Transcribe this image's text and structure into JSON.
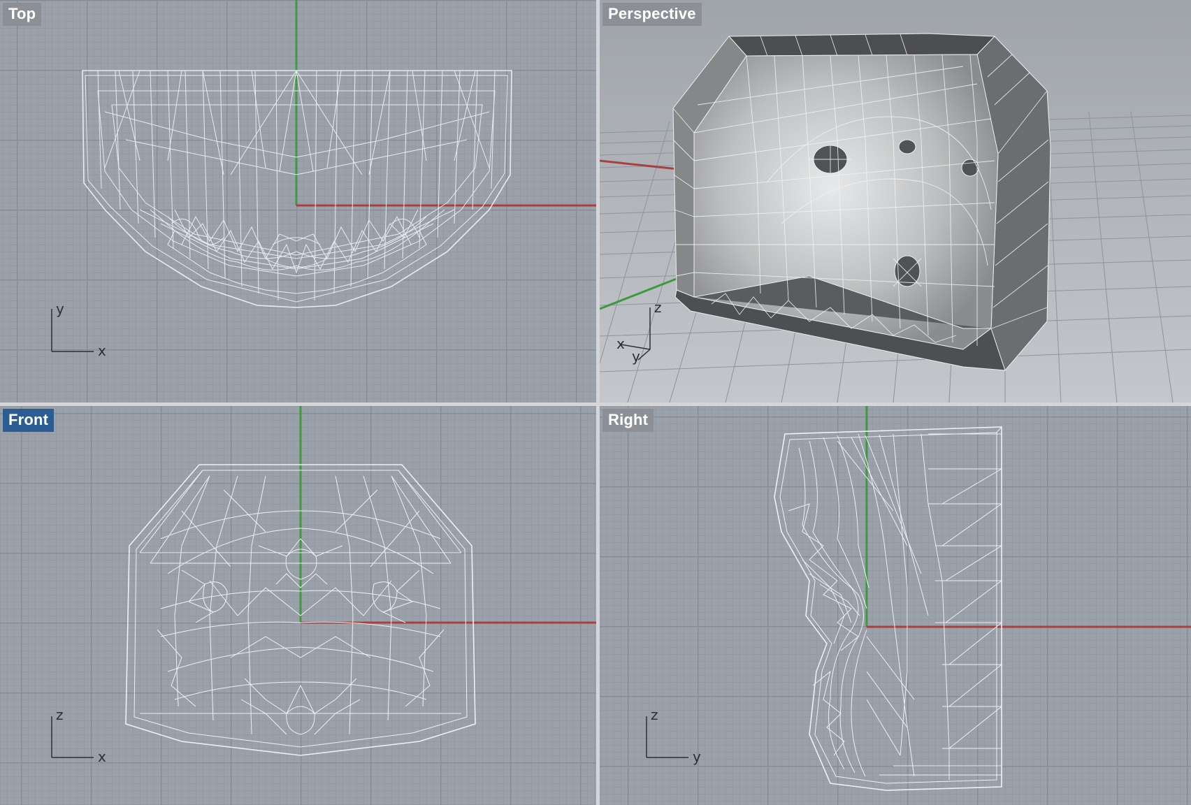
{
  "viewports": {
    "top": {
      "title": "Top",
      "axis_a": "y",
      "axis_b": "x",
      "active": false
    },
    "perspective": {
      "title": "Perspective",
      "axis_a": "z",
      "axis_b": "x",
      "axis_c": "y",
      "active": false
    },
    "front": {
      "title": "Front",
      "axis_a": "z",
      "axis_b": "x",
      "active": true
    },
    "right": {
      "title": "Right",
      "axis_a": "z",
      "axis_b": "y",
      "active": false
    }
  },
  "colors": {
    "x_axis": "#a8413d",
    "y_axis": "#3d9a3f",
    "wire": "#f2f3f5",
    "active_title": "#2b5d92",
    "inactive_title": "#8c9096"
  }
}
